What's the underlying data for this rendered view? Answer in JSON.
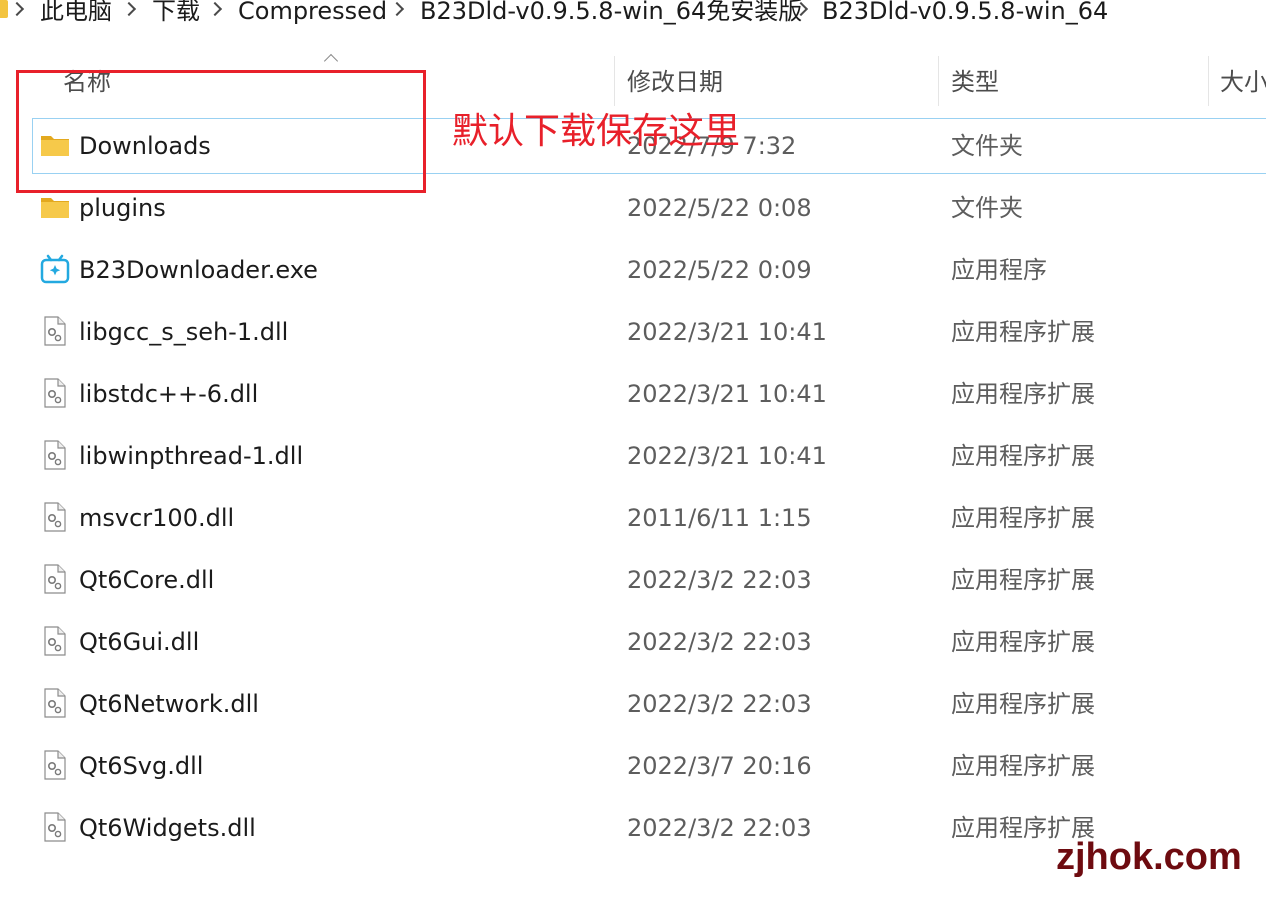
{
  "breadcrumb": [
    "此电脑",
    "下载",
    "Compressed",
    "B23Dld-v0.9.5.8-win_64免安装版",
    "B23Dld-v0.9.5.8-win_64"
  ],
  "columns": {
    "name": "名称",
    "date": "修改日期",
    "type": "类型",
    "size": "大小"
  },
  "files": [
    {
      "name": "Downloads",
      "date": "2022/7/9 7:32",
      "type": "文件夹",
      "icon": "folder-icon",
      "selected": true
    },
    {
      "name": "plugins",
      "date": "2022/5/22 0:08",
      "type": "文件夹",
      "icon": "folder-icon"
    },
    {
      "name": "B23Downloader.exe",
      "date": "2022/5/22 0:09",
      "type": "应用程序",
      "icon": "app-icon"
    },
    {
      "name": "libgcc_s_seh-1.dll",
      "date": "2022/3/21 10:41",
      "type": "应用程序扩展",
      "icon": "dll-file-icon"
    },
    {
      "name": "libstdc++-6.dll",
      "date": "2022/3/21 10:41",
      "type": "应用程序扩展",
      "icon": "dll-file-icon"
    },
    {
      "name": "libwinpthread-1.dll",
      "date": "2022/3/21 10:41",
      "type": "应用程序扩展",
      "icon": "dll-file-icon"
    },
    {
      "name": "msvcr100.dll",
      "date": "2011/6/11 1:15",
      "type": "应用程序扩展",
      "icon": "dll-file-icon"
    },
    {
      "name": "Qt6Core.dll",
      "date": "2022/3/2 22:03",
      "type": "应用程序扩展",
      "icon": "dll-file-icon"
    },
    {
      "name": "Qt6Gui.dll",
      "date": "2022/3/2 22:03",
      "type": "应用程序扩展",
      "icon": "dll-file-icon"
    },
    {
      "name": "Qt6Network.dll",
      "date": "2022/3/2 22:03",
      "type": "应用程序扩展",
      "icon": "dll-file-icon"
    },
    {
      "name": "Qt6Svg.dll",
      "date": "2022/3/7 20:16",
      "type": "应用程序扩展",
      "icon": "dll-file-icon"
    },
    {
      "name": "Qt6Widgets.dll",
      "date": "2022/3/2 22:03",
      "type": "应用程序扩展",
      "icon": "dll-file-icon"
    }
  ],
  "annotation": {
    "text": "默认下载保存这里",
    "color": "#e8202a"
  },
  "watermark": "zjhok.com",
  "colors": {
    "folder": "#f3c440",
    "selection_border": "#99d1f2",
    "app_icon": "#23a9e0"
  }
}
